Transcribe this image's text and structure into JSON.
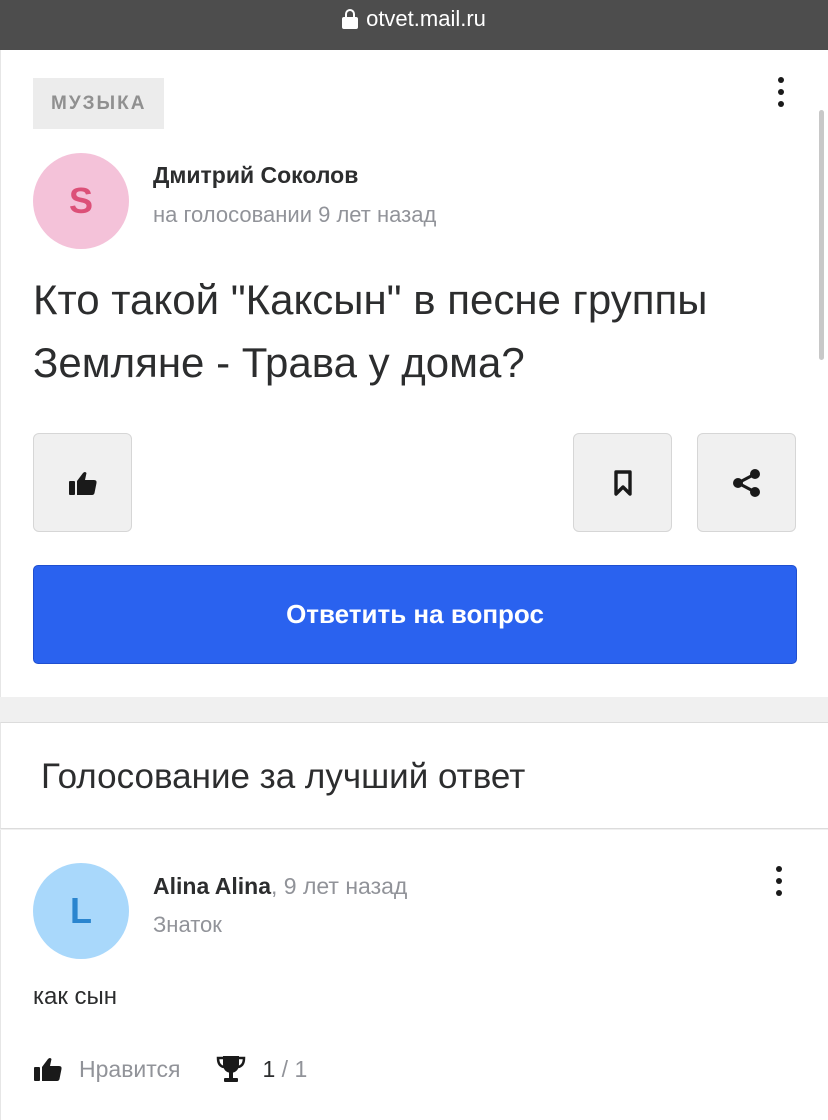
{
  "browser": {
    "url": "otvet.mail.ru"
  },
  "question": {
    "category": "МУЗЫКА",
    "author_initial": "S",
    "author_name": "Дмитрий Соколов",
    "status": "на голосовании 9 лет назад",
    "title": "Кто такой \"Каксын\" в песне группы Земляне - Трава у дома?",
    "answer_button_label": "Ответить на вопрос"
  },
  "voting": {
    "title": "Голосование за лучший ответ"
  },
  "answer": {
    "author_initial": "L",
    "author_name": "Alina Alina",
    "time": ", 9 лет назад",
    "rank": "Знаток",
    "text": "как сын",
    "like_label": "Нравится",
    "votes_current": "1",
    "votes_total": " / 1"
  },
  "colors": {
    "accent": "#2a62ef",
    "author_avatar_bg": "#f4c2d9",
    "answer_avatar_bg": "#a9d8fb"
  }
}
